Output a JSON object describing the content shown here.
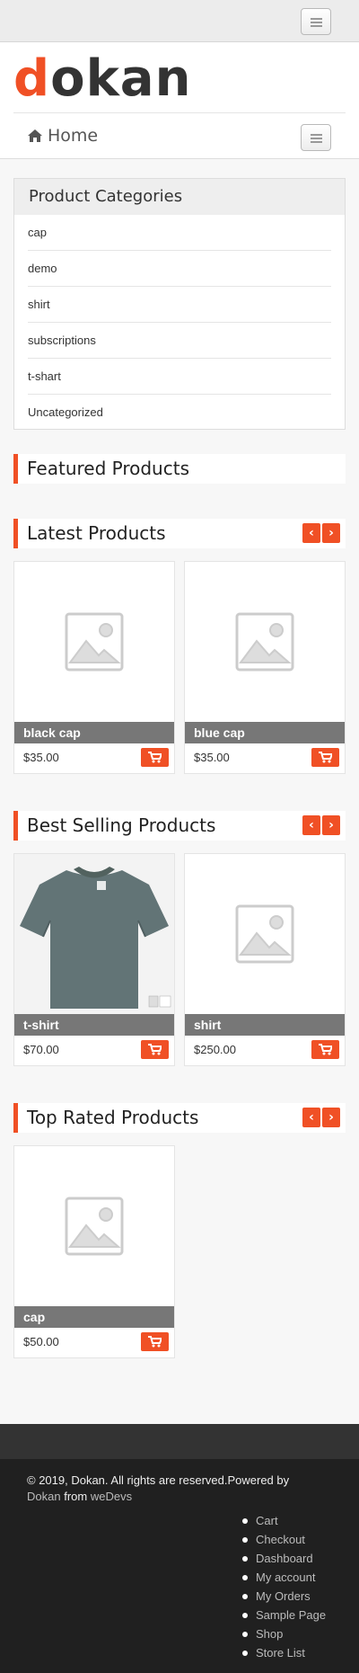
{
  "logo": {
    "first": "d",
    "rest": "okan"
  },
  "nav": {
    "home": "Home"
  },
  "categories": {
    "title": "Product Categories",
    "items": [
      "cap",
      "demo",
      "shirt",
      "subscriptions",
      "t-shart",
      "Uncategorized"
    ]
  },
  "sections": {
    "featured": "Featured Products",
    "latest": "Latest Products",
    "best": "Best Selling Products",
    "top": "Top Rated Products"
  },
  "arrows": {
    "prev": "‹",
    "next": "›"
  },
  "products": {
    "latest": [
      {
        "name": "black cap",
        "price": "$35.00"
      },
      {
        "name": "blue cap",
        "price": "$35.00"
      }
    ],
    "best": [
      {
        "name": "t-shirt",
        "price": "$70.00"
      },
      {
        "name": "shirt",
        "price": "$250.00"
      }
    ],
    "top": [
      {
        "name": "cap",
        "price": "$50.00"
      }
    ]
  },
  "footer": {
    "copyright": "© 2019, Dokan. All rights are reserved.Powered by",
    "brand": "Dokan",
    "from": "from",
    "company": "weDevs",
    "menu": [
      "Cart",
      "Checkout",
      "Dashboard",
      "My account",
      "My Orders",
      "Sample Page",
      "Shop",
      "Store List"
    ]
  },
  "colors": {
    "accent": "#f05025",
    "footer": "#202020"
  },
  "icons": {
    "home": "home-icon",
    "cart": "cart-icon",
    "placeholder": "image-placeholder-icon"
  }
}
